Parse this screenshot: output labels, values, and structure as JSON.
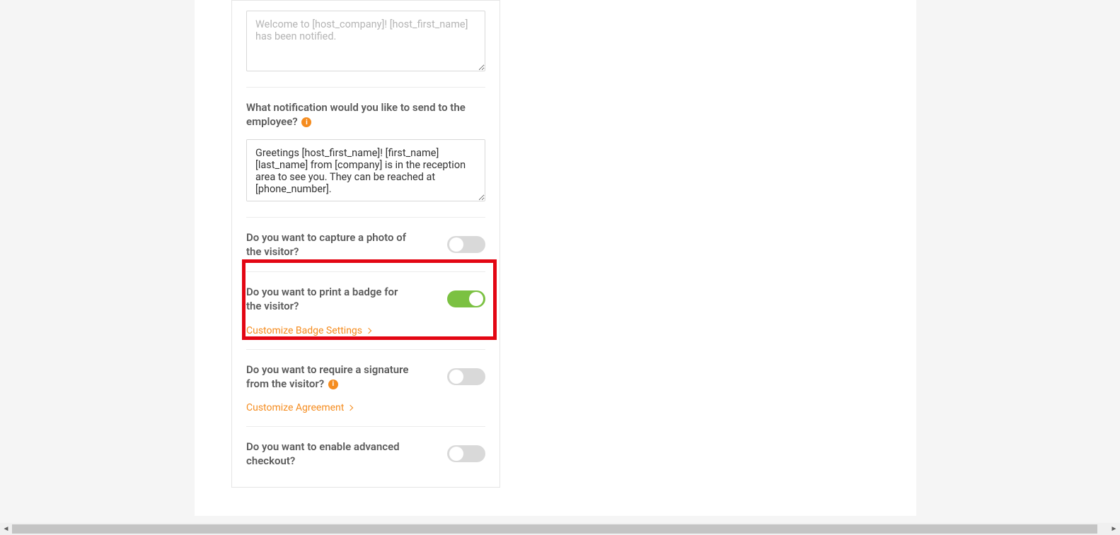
{
  "sections": {
    "visitor_msg": {
      "placeholder": "Welcome to [host_company]! [host_first_name] has been notified."
    },
    "employee_notify": {
      "label": "What notification would you like to send to the employee?",
      "value": "Greetings [host_first_name]! [first_name] [last_name] from [company] is in the reception area to see you. They can be reached at [phone_number]."
    },
    "capture_photo": {
      "label": "Do you want to capture a photo of the visitor?",
      "on": false
    },
    "print_badge": {
      "label": "Do you want to print a badge for the visitor?",
      "on": true,
      "link": "Customize Badge Settings"
    },
    "signature": {
      "label": "Do you want to require a signature from the visitor?",
      "on": false,
      "link": "Customize Agreement"
    },
    "advanced_checkout": {
      "label": "Do you want to enable advanced checkout?",
      "on": false
    }
  }
}
